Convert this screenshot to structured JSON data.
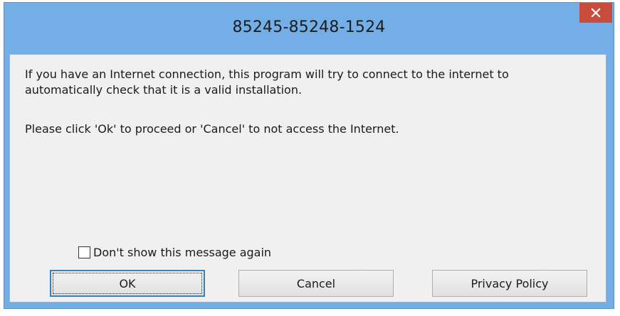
{
  "window": {
    "title": "85245-85248-1524",
    "close_symbol": "✕",
    "colors": {
      "frame": "#73aee6",
      "close_button": "#c74c3c",
      "client_bg": "#f0f0f0"
    }
  },
  "message": {
    "paragraph1": "If you have an Internet connection, this program will try to connect to the internet to automatically check that it is a valid installation.",
    "paragraph2": "Please click 'Ok' to proceed or 'Cancel' to not access the Internet."
  },
  "checkbox": {
    "label": "Don't show this message again",
    "checked": false
  },
  "buttons": {
    "ok_label": "OK",
    "cancel_label": "Cancel",
    "privacy_label": "Privacy Policy"
  }
}
